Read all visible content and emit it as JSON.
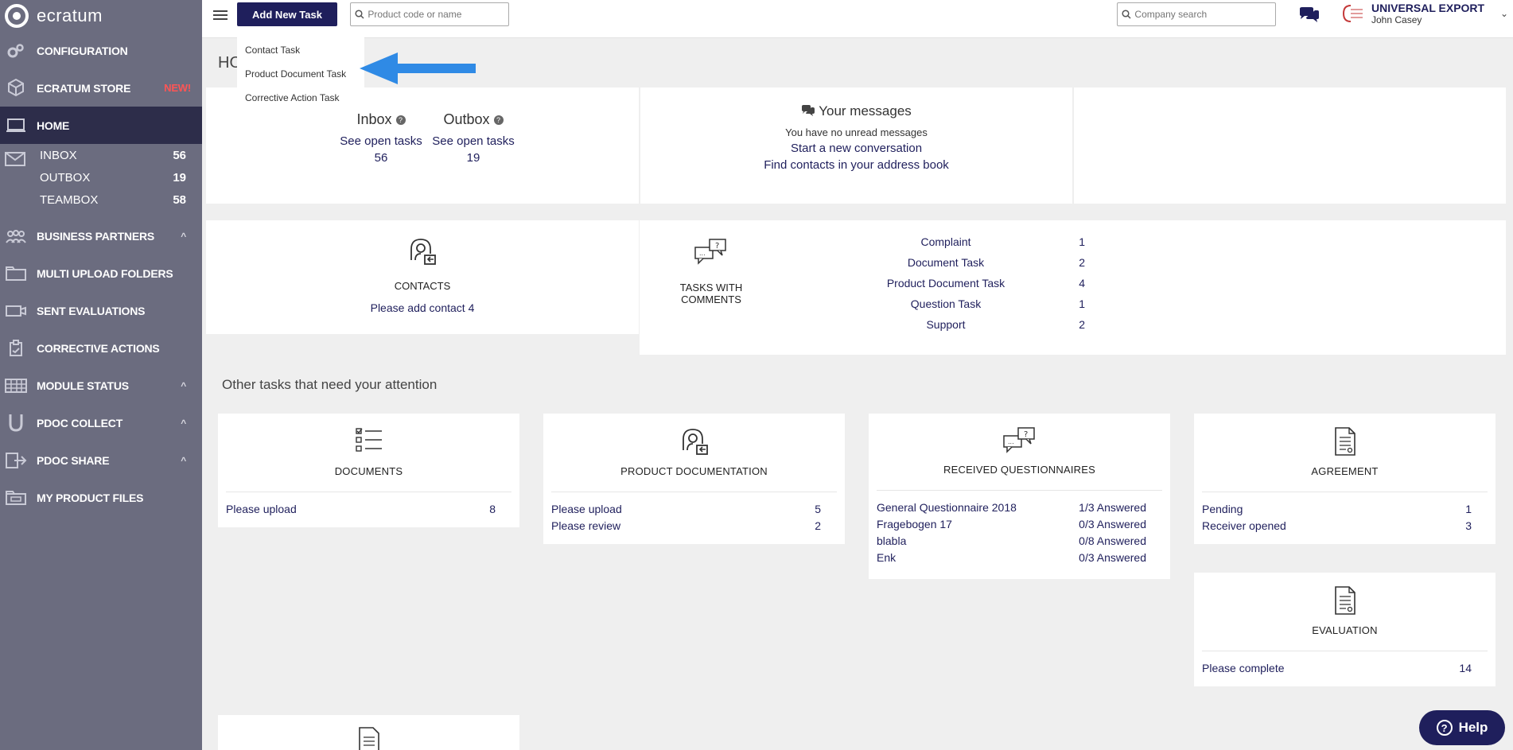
{
  "sidebar": {
    "brand": "ecratum",
    "items": [
      {
        "label": "CONFIGURATION",
        "icon": "gears-icon"
      },
      {
        "label": "ECRATUM STORE",
        "icon": "cubes-icon",
        "badge": "NEW!"
      },
      {
        "label": "HOME",
        "icon": "laptop-icon",
        "active": true
      }
    ],
    "mailbox": [
      {
        "label": "INBOX",
        "count": "56"
      },
      {
        "label": "OUTBOX",
        "count": "19"
      },
      {
        "label": "TEAMBOX",
        "count": "58"
      }
    ],
    "items2": [
      {
        "label": "BUSINESS PARTNERS",
        "icon": "people-icon"
      },
      {
        "label": "MULTI UPLOAD FOLDERS",
        "icon": "folders-icon"
      },
      {
        "label": "SENT EVALUATIONS",
        "icon": "evaluation-icon"
      },
      {
        "label": "CORRECTIVE ACTIONS",
        "icon": "clipboard-icon"
      },
      {
        "label": "MODULE STATUS",
        "icon": "grid-icon"
      },
      {
        "label": "PDOC COLLECT",
        "icon": "magnet-icon"
      },
      {
        "label": "PDOC SHARE",
        "icon": "share-icon"
      },
      {
        "label": "MY PRODUCT FILES",
        "icon": "files-icon"
      }
    ]
  },
  "topbar": {
    "add_task_label": "Add New Task",
    "product_search_placeholder": "Product code or name",
    "company_search_placeholder": "Company search",
    "company_name": "UNIVERSAL EXPORT",
    "user_name": "John Casey"
  },
  "dropdown": {
    "items": [
      "Contact Task",
      "Product Document Task",
      "Corrective Action Task"
    ]
  },
  "home": {
    "title": "HO",
    "inbox": {
      "label": "Inbox",
      "link": "See open tasks",
      "count": "56"
    },
    "outbox": {
      "label": "Outbox",
      "link": "See open tasks",
      "count": "19"
    },
    "messages": {
      "title": "Your messages",
      "line1": "You have no unread messages",
      "line2": "Start a new conversation",
      "line3": "Find contacts in your address book"
    },
    "contacts": {
      "title": "CONTACTS",
      "link": "Please add contact 4"
    },
    "tasks_comments": {
      "title": "TASKS WITH COMMENTS",
      "rows": [
        {
          "label": "Complaint",
          "count": "1"
        },
        {
          "label": "Document Task",
          "count": "2"
        },
        {
          "label": "Product Document Task",
          "count": "4"
        },
        {
          "label": "Question Task",
          "count": "1"
        },
        {
          "label": "Support",
          "count": "2"
        }
      ]
    },
    "other_title": "Other tasks that need your attention",
    "cards": {
      "documents": {
        "title": "DOCUMENTS",
        "rows": [
          {
            "label": "Please upload",
            "value": "8"
          }
        ]
      },
      "product_documentation": {
        "title": "PRODUCT DOCUMENTATION",
        "rows": [
          {
            "label": "Please upload",
            "value": "5"
          },
          {
            "label": "Please review",
            "value": "2"
          }
        ]
      },
      "received_questionnaires": {
        "title": "RECEIVED QUESTIONNAIRES",
        "rows": [
          {
            "label": "General Questionnaire 2018",
            "value": "1/3 Answered"
          },
          {
            "label": "Fragebogen 17",
            "value": "0/3 Answered"
          },
          {
            "label": "blabla",
            "value": "0/8 Answered"
          },
          {
            "label": "Enk",
            "value": "0/3 Answered"
          }
        ]
      },
      "agreement": {
        "title": "AGREEMENT",
        "rows": [
          {
            "label": "Pending",
            "value": "1"
          },
          {
            "label": "Receiver opened",
            "value": "3"
          }
        ]
      },
      "evaluation": {
        "title": "EVALUATION",
        "rows": [
          {
            "label": "Please complete",
            "value": "14"
          }
        ]
      }
    }
  },
  "help": {
    "label": "Help"
  },
  "colors": {
    "sidebar": "#6b6c7f",
    "sidebar_active": "#2d2d4a",
    "primary": "#1f1f5c",
    "arrow": "#2f8ae5",
    "new_badge": "#ff5555"
  }
}
